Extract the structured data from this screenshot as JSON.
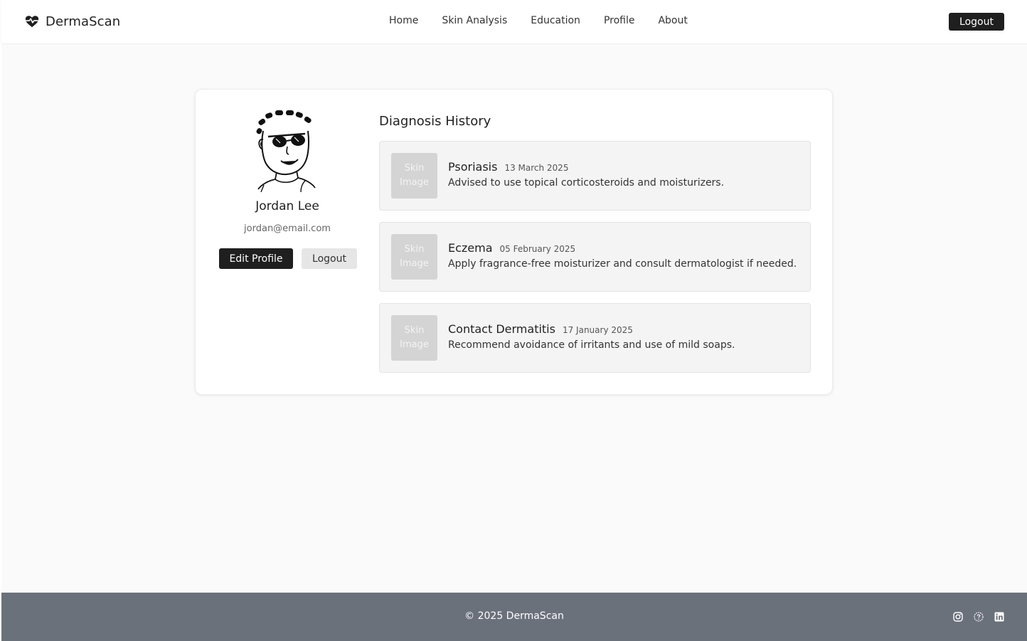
{
  "brand": {
    "name": "DermaScan",
    "logo_icon": "heart-pulse-icon"
  },
  "nav": {
    "items": [
      {
        "label": "Home"
      },
      {
        "label": "Skin Analysis"
      },
      {
        "label": "Education"
      },
      {
        "label": "Profile"
      },
      {
        "label": "About"
      }
    ],
    "logout_label": "Logout"
  },
  "profile": {
    "avatar_icon": "cartoon-avatar",
    "name": "Jordan Lee",
    "email": "jordan@email.com",
    "edit_label": "Edit Profile",
    "logout_label": "Logout"
  },
  "history": {
    "title": "Diagnosis History",
    "entries": [
      {
        "thumb_label": "Skin Image",
        "condition": "Psoriasis",
        "date": "13 March 2025",
        "note": "Advised to use topical corticosteroids and moisturizers."
      },
      {
        "thumb_label": "Skin Image",
        "condition": "Eczema",
        "date": "05 February 2025",
        "note": "Apply fragrance-free moisturizer and consult dermatologist if needed."
      },
      {
        "thumb_label": "Skin Image",
        "condition": "Contact Dermatitis",
        "date": "17 January 2025",
        "note": "Recommend avoidance of irritants and use of mild soaps."
      }
    ]
  },
  "footer": {
    "copyright": "© 2025 DermaScan",
    "socials": [
      "instagram-icon",
      "help-icon",
      "linkedin-icon"
    ]
  },
  "colors": {
    "primary_dark": "#1f1f1f",
    "footer_bg": "#6b717b",
    "page_bg": "#fafafa"
  }
}
